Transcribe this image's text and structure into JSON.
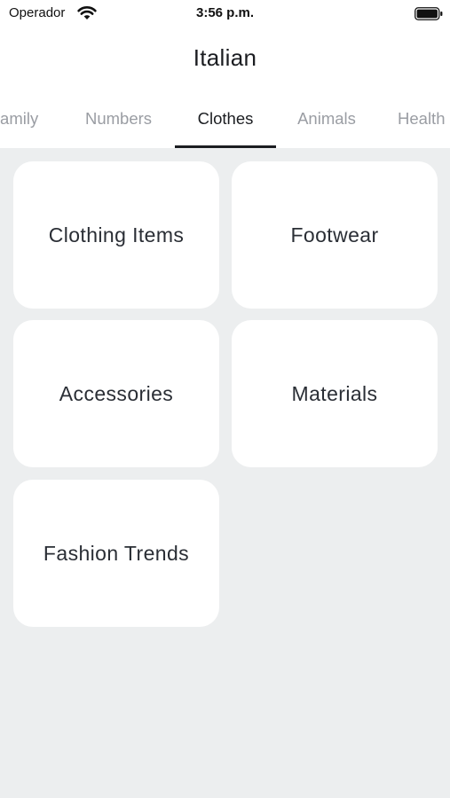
{
  "status_bar": {
    "carrier": "Operador",
    "time": "3:56 p.m."
  },
  "header": {
    "title": "Italian"
  },
  "tabs": [
    {
      "label": "Family",
      "active": false
    },
    {
      "label": "Numbers",
      "active": false
    },
    {
      "label": "Clothes",
      "active": true
    },
    {
      "label": "Animals",
      "active": false
    },
    {
      "label": "Health",
      "active": false
    }
  ],
  "categories": [
    {
      "label": "Clothing Items"
    },
    {
      "label": "Footwear"
    },
    {
      "label": "Accessories"
    },
    {
      "label": "Materials"
    },
    {
      "label": "Fashion Trends"
    }
  ],
  "colors": {
    "background": "#eceeef",
    "card": "#ffffff",
    "active_tab": "#1b1d21",
    "inactive_tab": "#9a9da3"
  }
}
